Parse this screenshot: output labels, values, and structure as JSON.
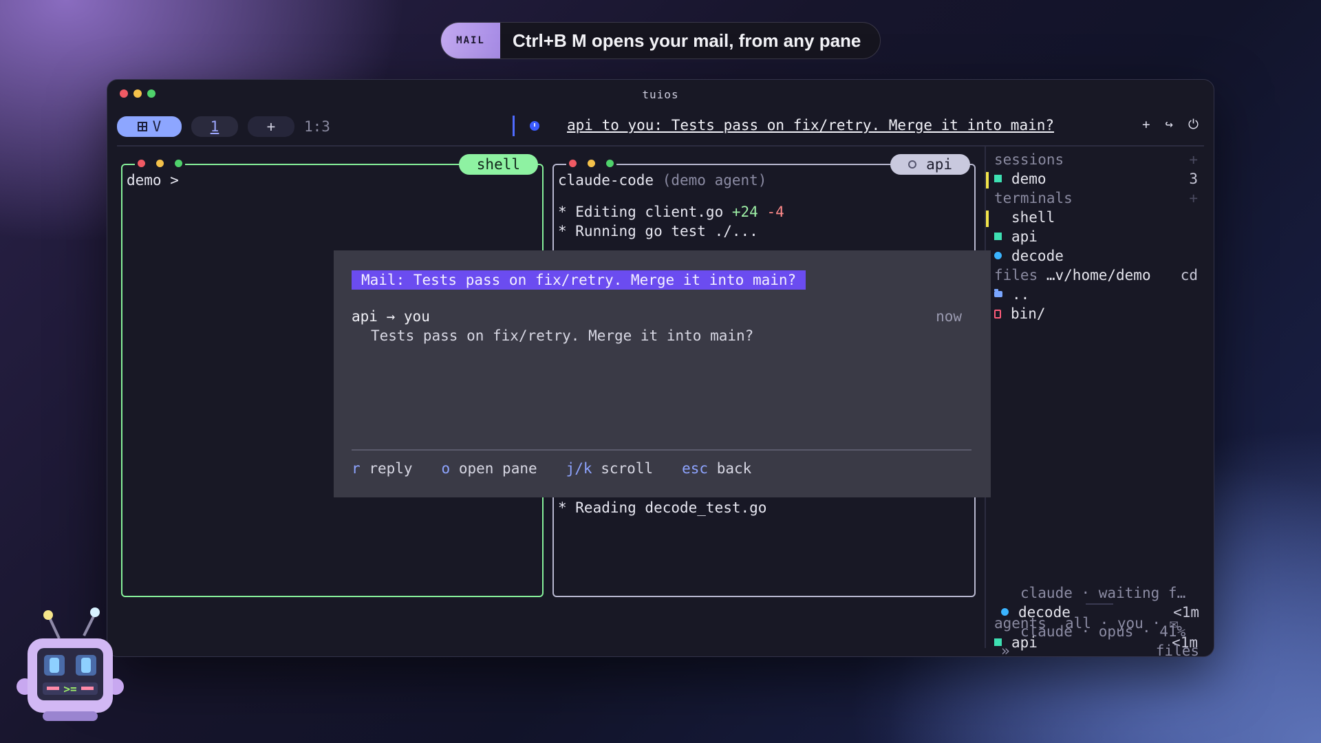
{
  "toast": {
    "badge": "MAIL",
    "message": "Ctrl+B M opens your mail, from any pane"
  },
  "window": {
    "title": "tuios"
  },
  "tabbar": {
    "view_label": "V",
    "tab_number": "1",
    "add_label": "+",
    "position": "1:3",
    "notification": "api to you: Tests pass on fix/retry. Merge it into main?",
    "icons": [
      "plus-icon",
      "detach-icon",
      "power-icon"
    ]
  },
  "panes": {
    "shell": {
      "title": "shell",
      "prompt": "demo >"
    },
    "api": {
      "title": "api",
      "header": "claude-code",
      "header_note": "(demo agent)",
      "line1_prefix": "* Editing client.go ",
      "line1_add": "+24",
      "line1_del": "-4",
      "line2": "* Running go test ./...",
      "line3": "* Reading decode_test.go"
    }
  },
  "mail": {
    "title": "Mail: Tests pass on fix/retry. Merge it into main?",
    "from": "api",
    "arrow": "→",
    "to": "you",
    "time": "now",
    "body": "Tests pass on fix/retry. Merge it into main?",
    "actions": [
      {
        "key": "r",
        "label": "reply"
      },
      {
        "key": "o",
        "label": "open pane"
      },
      {
        "key": "j/k",
        "label": "scroll"
      },
      {
        "key": "esc",
        "label": "back"
      }
    ]
  },
  "sidebar": {
    "sessions_label": "sessions",
    "sessions_plus": "+",
    "session": {
      "name": "demo",
      "count": "3"
    },
    "terminals_label": "terminals",
    "terminals_plus": "+",
    "terminals": [
      "shell",
      "api",
      "decode"
    ],
    "files_label": "files",
    "files_path": "…v/home/demo",
    "files_cd": "cd",
    "files": [
      "..",
      "bin/"
    ],
    "agents_label": "agents",
    "agents_filter": "all · you · ✉",
    "agents": [
      {
        "name": "api",
        "time": "<1m",
        "detail": "claude · waiting f…"
      },
      {
        "name": "decode",
        "time": "<1m",
        "detail": "claude · opus · 41%"
      }
    ],
    "footer_chevron": "»",
    "footer_label": "files"
  },
  "colors": {
    "accent": "#6b4cf0",
    "shell_border": "#86f09a",
    "tab_active": "#8da6ff",
    "session_marker": "#f2e44a",
    "agent_green": "#3ee0b2",
    "agent_blue": "#3ab4ff"
  }
}
